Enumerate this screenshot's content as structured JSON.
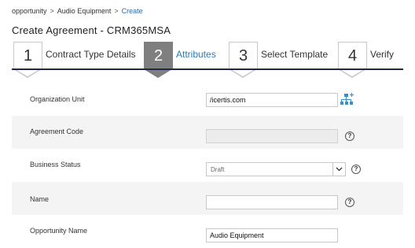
{
  "breadcrumb": {
    "items": [
      "opportunity",
      "Audio Equipment",
      "Create"
    ],
    "separator": ">"
  },
  "page": {
    "title": "Create Agreement - CRM365MSA"
  },
  "steps": [
    {
      "number": "1",
      "label": "Contract Type Details",
      "active": false
    },
    {
      "number": "2",
      "label": "Attributes",
      "active": true
    },
    {
      "number": "3",
      "label": "Select Template",
      "active": false
    },
    {
      "number": "4",
      "label": "Verify",
      "active": false
    }
  ],
  "form": {
    "organization_unit": {
      "label": "Organization Unit",
      "value": "/icertis.com",
      "icon": "org-hierarchy-icon"
    },
    "agreement_code": {
      "label": "Agreement Code",
      "value": "",
      "help": "?"
    },
    "business_status": {
      "label": "Business Status",
      "value": "Draft",
      "help": "?"
    },
    "name": {
      "label": "Name",
      "value": "",
      "help": "?"
    },
    "opportunity_name": {
      "label": "Opportunity Name",
      "value": "Audio Equipment"
    }
  },
  "colors": {
    "active_step_bg": "#7f7f7f",
    "active_step_label": "#2a7ab8",
    "progress_line": "#1e2a4a",
    "link": "#2a6aa8",
    "org_icon": "#3a8fc8"
  }
}
